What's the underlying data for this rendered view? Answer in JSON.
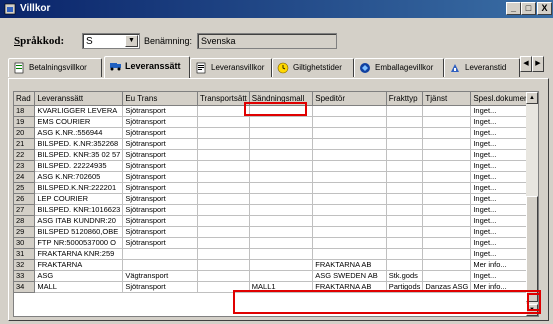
{
  "window": {
    "title": "Villkor",
    "buttons": {
      "minimize": "_",
      "maximize": "□",
      "close": "X"
    }
  },
  "language": {
    "label_prefix": "S",
    "label_rest": "pråkkod:",
    "value": "S",
    "name_label": "Benämning:",
    "name_value": "Svenska"
  },
  "tabs": [
    {
      "label": "Betalningsvillkor",
      "icon": "payment-icon"
    },
    {
      "label": "Leveranssätt",
      "icon": "truck-icon",
      "active": true
    },
    {
      "label": "Leveransvillkor",
      "icon": "document-icon"
    },
    {
      "label": "Giltighetstider",
      "icon": "clock-icon"
    },
    {
      "label": "Emballagevillkor",
      "icon": "package-icon"
    },
    {
      "label": "Leveranstid",
      "icon": "delivery-time-icon"
    }
  ],
  "grid": {
    "columns": [
      "Rad",
      "Leveranssätt",
      "Eu Trans",
      "Transportsätt",
      "Sändningsmall",
      "Speditör",
      "Frakttyp",
      "Tjänst",
      "Spesl.dokument"
    ],
    "rows": [
      [
        "18",
        "KVARLIGGER LEVERA",
        "Sjötransport",
        "",
        "",
        "",
        "",
        "",
        "Inget..."
      ],
      [
        "19",
        "EMS COURIER",
        "Sjötransport",
        "",
        "",
        "",
        "",
        "",
        "Inget..."
      ],
      [
        "20",
        "ASG K.NR.:556944",
        "Sjötransport",
        "",
        "",
        "",
        "",
        "",
        "Inget..."
      ],
      [
        "21",
        "BILSPED. K.NR:352268",
        "Sjötransport",
        "",
        "",
        "",
        "",
        "",
        "Inget..."
      ],
      [
        "22",
        "BILSPED. KNR:35 02 57",
        "Sjötransport",
        "",
        "",
        "",
        "",
        "",
        "Inget..."
      ],
      [
        "23",
        "BILSPED. 22224935",
        "Sjötransport",
        "",
        "",
        "",
        "",
        "",
        "Inget..."
      ],
      [
        "24",
        "ASG K.NR:702605",
        "Sjötransport",
        "",
        "",
        "",
        "",
        "",
        "Inget..."
      ],
      [
        "25",
        "BILSPED.K.NR:222201",
        "Sjötransport",
        "",
        "",
        "",
        "",
        "",
        "Inget..."
      ],
      [
        "26",
        "LEP COURIER",
        "Sjötransport",
        "",
        "",
        "",
        "",
        "",
        "Inget..."
      ],
      [
        "27",
        "BILSPED. KNR:1016623",
        "Sjötransport",
        "",
        "",
        "",
        "",
        "",
        "Inget..."
      ],
      [
        "28",
        "ASG ITAB KUNDNR:20",
        "Sjötransport",
        "",
        "",
        "",
        "",
        "",
        "Inget..."
      ],
      [
        "29",
        "BILSPED 5120860,OBE",
        "Sjötransport",
        "",
        "",
        "",
        "",
        "",
        "Inget..."
      ],
      [
        "30",
        "FTP NR:5000537000 O",
        "Sjötransport",
        "",
        "",
        "",
        "",
        "",
        "Inget..."
      ],
      [
        "31",
        "FRAKTARNA KNR:259",
        "",
        "",
        "",
        "",
        "",
        "",
        "Inget..."
      ],
      [
        "32",
        "FRAKTARNA",
        "",
        "",
        "",
        "FRAKTARNA AB",
        "",
        "",
        "Mer info..."
      ],
      [
        "33",
        "ASG",
        "Vägtransport",
        "",
        "",
        "ASG SWEDEN AB",
        "Stk.gods",
        "",
        "Inget..."
      ],
      [
        "34",
        "MALL",
        "Sjötransport",
        "",
        "MALL1",
        "FRAKTARNA AB",
        "Partigods",
        "Danzas ASG",
        "Mer info..."
      ]
    ]
  },
  "colors": {
    "highlight": "#e00000",
    "titlebar": "#0a246a"
  }
}
